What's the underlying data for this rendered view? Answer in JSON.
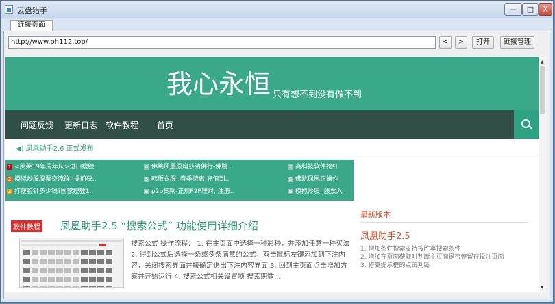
{
  "window": {
    "title": "云盘猎手",
    "min": "—",
    "max": "□",
    "close": "X"
  },
  "tab": {
    "label": "连接页面"
  },
  "toolbar": {
    "url": "http://www.ph112.top/",
    "back": "<",
    "forward": ">",
    "open": "打开",
    "links": "链接管理"
  },
  "site": {
    "banner_main": "我心永恒",
    "banner_sub": "只有想不到没有做不到",
    "nav": [
      "问题反馈",
      "更新日志",
      "软件教程",
      "首页"
    ],
    "notice": "凤凰助手2.6 正式发布",
    "ticker": [
      [
        "<美莱19年周年庆>进口瘦脸..",
        "佛跳风凰原扁莎请佛行-佛跳..",
        "高科技软件抢红"
      ],
      [
        "模拟炒股股票交流群, 提前获..",
        "韩版衣服, 春季特惠 充值到..",
        "佛跳凤凰正操作"
      ],
      [
        "打瘦脸针多少钱?国家瘦教1..",
        "p2p贷款-正规P2P理财, 注册..",
        "模拟炒股, 股票入"
      ]
    ],
    "latest": {
      "heading": "最新版本",
      "title": "凤凰助手2.5",
      "notes": [
        "1. 增加条件搜索支持按胜率搜索条件",
        "2. 增加在页面获取时判断主页面是否停留在投注页面",
        "3. 修复提示框的点击判断"
      ]
    },
    "article": {
      "badge": "软件教程",
      "title": "凤凰助手2.5 “搜索公式” 功能使用详细介绍",
      "text": "搜索公式 操作流程： 1. 在主页面中选择一种彩种，并添加任意一种买法 2. 得到公式后选择一条或多条满意的公式，双击鼠标左键添加到下注内容，关闭搜索界面并接确定退出下注内容界面 3. 回到主页面点击增加方案并开始运行 4. 搜索公式相关设置项 搜索期数..."
    }
  }
}
